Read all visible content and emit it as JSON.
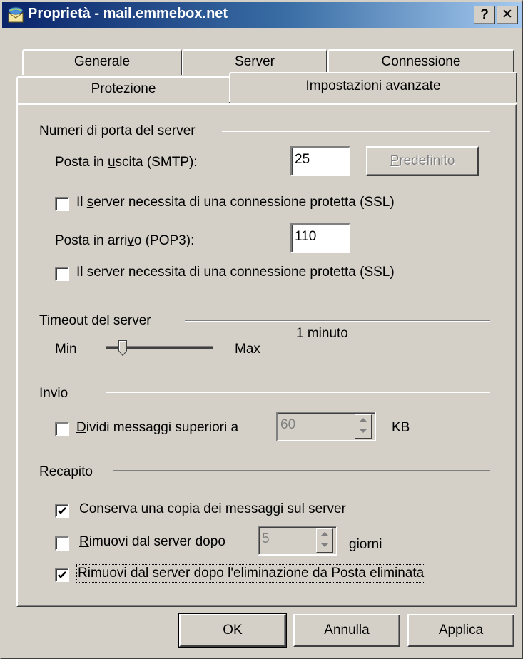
{
  "window": {
    "title": "Proprietà - mail.emmebox.net",
    "help_glyph": "?",
    "close_glyph": "✕"
  },
  "tabs": [
    {
      "label": "Generale"
    },
    {
      "label": "Server"
    },
    {
      "label": "Connessione"
    },
    {
      "label": "Protezione"
    },
    {
      "label": "Impostazioni avanzate",
      "active": true
    }
  ],
  "ports": {
    "group_label": "Numeri di porta del server",
    "smtp_label_pre": "Posta in ",
    "smtp_label_u": "u",
    "smtp_label_post": "scita (SMTP):",
    "smtp_value": "25",
    "default_button_u": "P",
    "default_button_rest": "redefinito",
    "ssl_smtp_pre": "Il ",
    "ssl_smtp_u": "s",
    "ssl_smtp_post": "erver necessita di una connessione protetta (SSL)",
    "ssl_smtp_checked": false,
    "pop3_label_pre": "Posta in arri",
    "pop3_label_u": "v",
    "pop3_label_post": "o (POP3):",
    "pop3_value": "110",
    "ssl_pop3_pre": "Il s",
    "ssl_pop3_u": "e",
    "ssl_pop3_post": "rver necessita di una connessione protetta (SSL)",
    "ssl_pop3_checked": false
  },
  "timeout": {
    "group_label": "Timeout del server",
    "min_label": "Min",
    "max_label": "Max",
    "value_label": "1 minuto",
    "slider_fraction": 0.12
  },
  "send": {
    "group_label": "Invio",
    "split_u": "D",
    "split_rest": "ividi messaggi superiori a",
    "split_checked": false,
    "split_value": "60",
    "unit": "KB"
  },
  "delivery": {
    "group_label": "Recapito",
    "keep_u": "C",
    "keep_rest": "onserva una copia dei messaggi sul server",
    "keep_checked": true,
    "remove_after_u": "R",
    "remove_after_rest": "imuovi dal server dopo",
    "remove_after_checked": false,
    "remove_after_value": "5",
    "days_label": "giorni",
    "remove_deleted_pre": "Rimuovi dal server dopo l'elimina",
    "remove_deleted_u": "z",
    "remove_deleted_post": "ione da Posta eliminata",
    "remove_deleted_checked": true
  },
  "footer": {
    "ok": "OK",
    "cancel": "Annulla",
    "apply_u": "A",
    "apply_rest": "pplica"
  }
}
